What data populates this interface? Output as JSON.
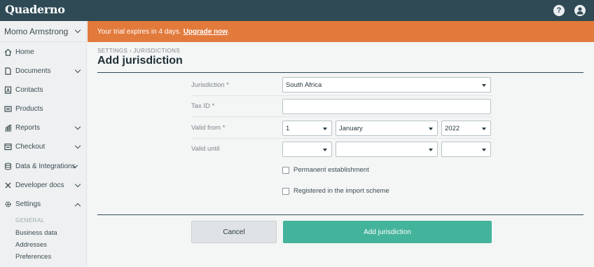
{
  "app": {
    "logo": "Quaderno"
  },
  "topbar": {
    "help_icon": "question-circle-icon",
    "user_icon": "user-icon"
  },
  "sidebar": {
    "account_name": "Momo Armstrong",
    "items": [
      {
        "label": "Home",
        "icon": "home-icon",
        "expandable": false
      },
      {
        "label": "Documents",
        "icon": "document-icon",
        "expandable": true
      },
      {
        "label": "Contacts",
        "icon": "contact-card-icon",
        "expandable": false
      },
      {
        "label": "Products",
        "icon": "products-icon",
        "expandable": false
      },
      {
        "label": "Reports",
        "icon": "chart-icon",
        "expandable": true
      },
      {
        "label": "Checkout",
        "icon": "checkout-icon",
        "expandable": true
      },
      {
        "label": "Data & Integrations",
        "icon": "database-icon",
        "expandable": true
      },
      {
        "label": "Developer docs",
        "icon": "tools-icon",
        "expandable": true
      },
      {
        "label": "Settings",
        "icon": "gear-icon",
        "expandable": true,
        "expanded": true
      }
    ],
    "settings_section": "GENERAL",
    "settings_items": [
      "Business data",
      "Addresses",
      "Preferences"
    ]
  },
  "banner": {
    "text": "Your trial expires in 4 days.",
    "link": "Upgrade now",
    "suffix": ".",
    "color": "#e27a3c"
  },
  "main": {
    "breadcrumb": "SETTINGS › JURISDICTIONS",
    "title": "Add jurisdiction"
  },
  "form": {
    "jurisdiction_label": "Jurisdiction *",
    "jurisdiction_value": "South Africa",
    "tax_id_label": "Tax ID *",
    "tax_id_value": "",
    "valid_from_label": "Valid from *",
    "valid_from_day": "1",
    "valid_from_month": "January",
    "valid_from_year": "2022",
    "valid_until_label": "Valid until",
    "valid_until_day": "",
    "valid_until_month": "",
    "valid_until_year": "",
    "permanent_establishment_label": "Permanent establishment",
    "import_scheme_label": "Registered in the import scheme",
    "cancel_label": "Cancel",
    "submit_label": "Add jurisdiction",
    "accent_color": "#44b39c"
  }
}
